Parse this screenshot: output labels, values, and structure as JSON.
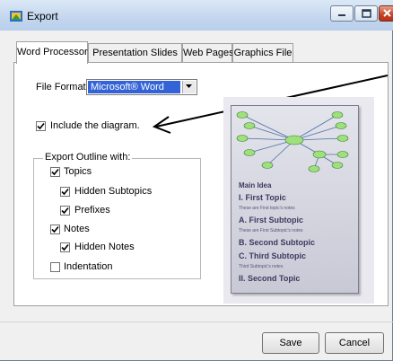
{
  "window": {
    "title": "Export"
  },
  "tabs": [
    {
      "label": "Word Processor",
      "active": true
    },
    {
      "label": "Presentation Slides",
      "active": false
    },
    {
      "label": "Web Pages",
      "active": false
    },
    {
      "label": "Graphics File",
      "active": false
    }
  ],
  "format": {
    "label": "File Format:",
    "value": "Microsoft® Word"
  },
  "include_diagram": {
    "label": "Include the diagram.",
    "checked": true
  },
  "outline": {
    "legend": "Export Outline with:",
    "options": [
      {
        "label": "Topics",
        "checked": true
      },
      {
        "label": "Hidden Subtopics",
        "checked": true
      },
      {
        "label": "Prefixes",
        "checked": true
      },
      {
        "label": "Notes",
        "checked": true
      },
      {
        "label": "Hidden Notes",
        "checked": true
      },
      {
        "label": "Indentation",
        "checked": false
      }
    ]
  },
  "preview": {
    "main_idea": "Main Idea",
    "items": [
      {
        "heading": "I. First Topic",
        "note": "These are First topic's notes"
      },
      {
        "heading": "A. First Subtopic",
        "note": "These are First Subtopic's notes"
      },
      {
        "heading": "B. Second Subtopic",
        "note": ""
      },
      {
        "heading": "C. Third Subtopic",
        "note": "Third Subtopic's notes"
      },
      {
        "heading": "II. Second Topic",
        "note": ""
      }
    ]
  },
  "buttons": {
    "save": "Save",
    "cancel": "Cancel"
  },
  "colors": {
    "title_gradient_top": "#dbe8f6",
    "selection": "#3363d6",
    "close_button": "#c7452a",
    "diagram_node": "#9ee07a"
  }
}
